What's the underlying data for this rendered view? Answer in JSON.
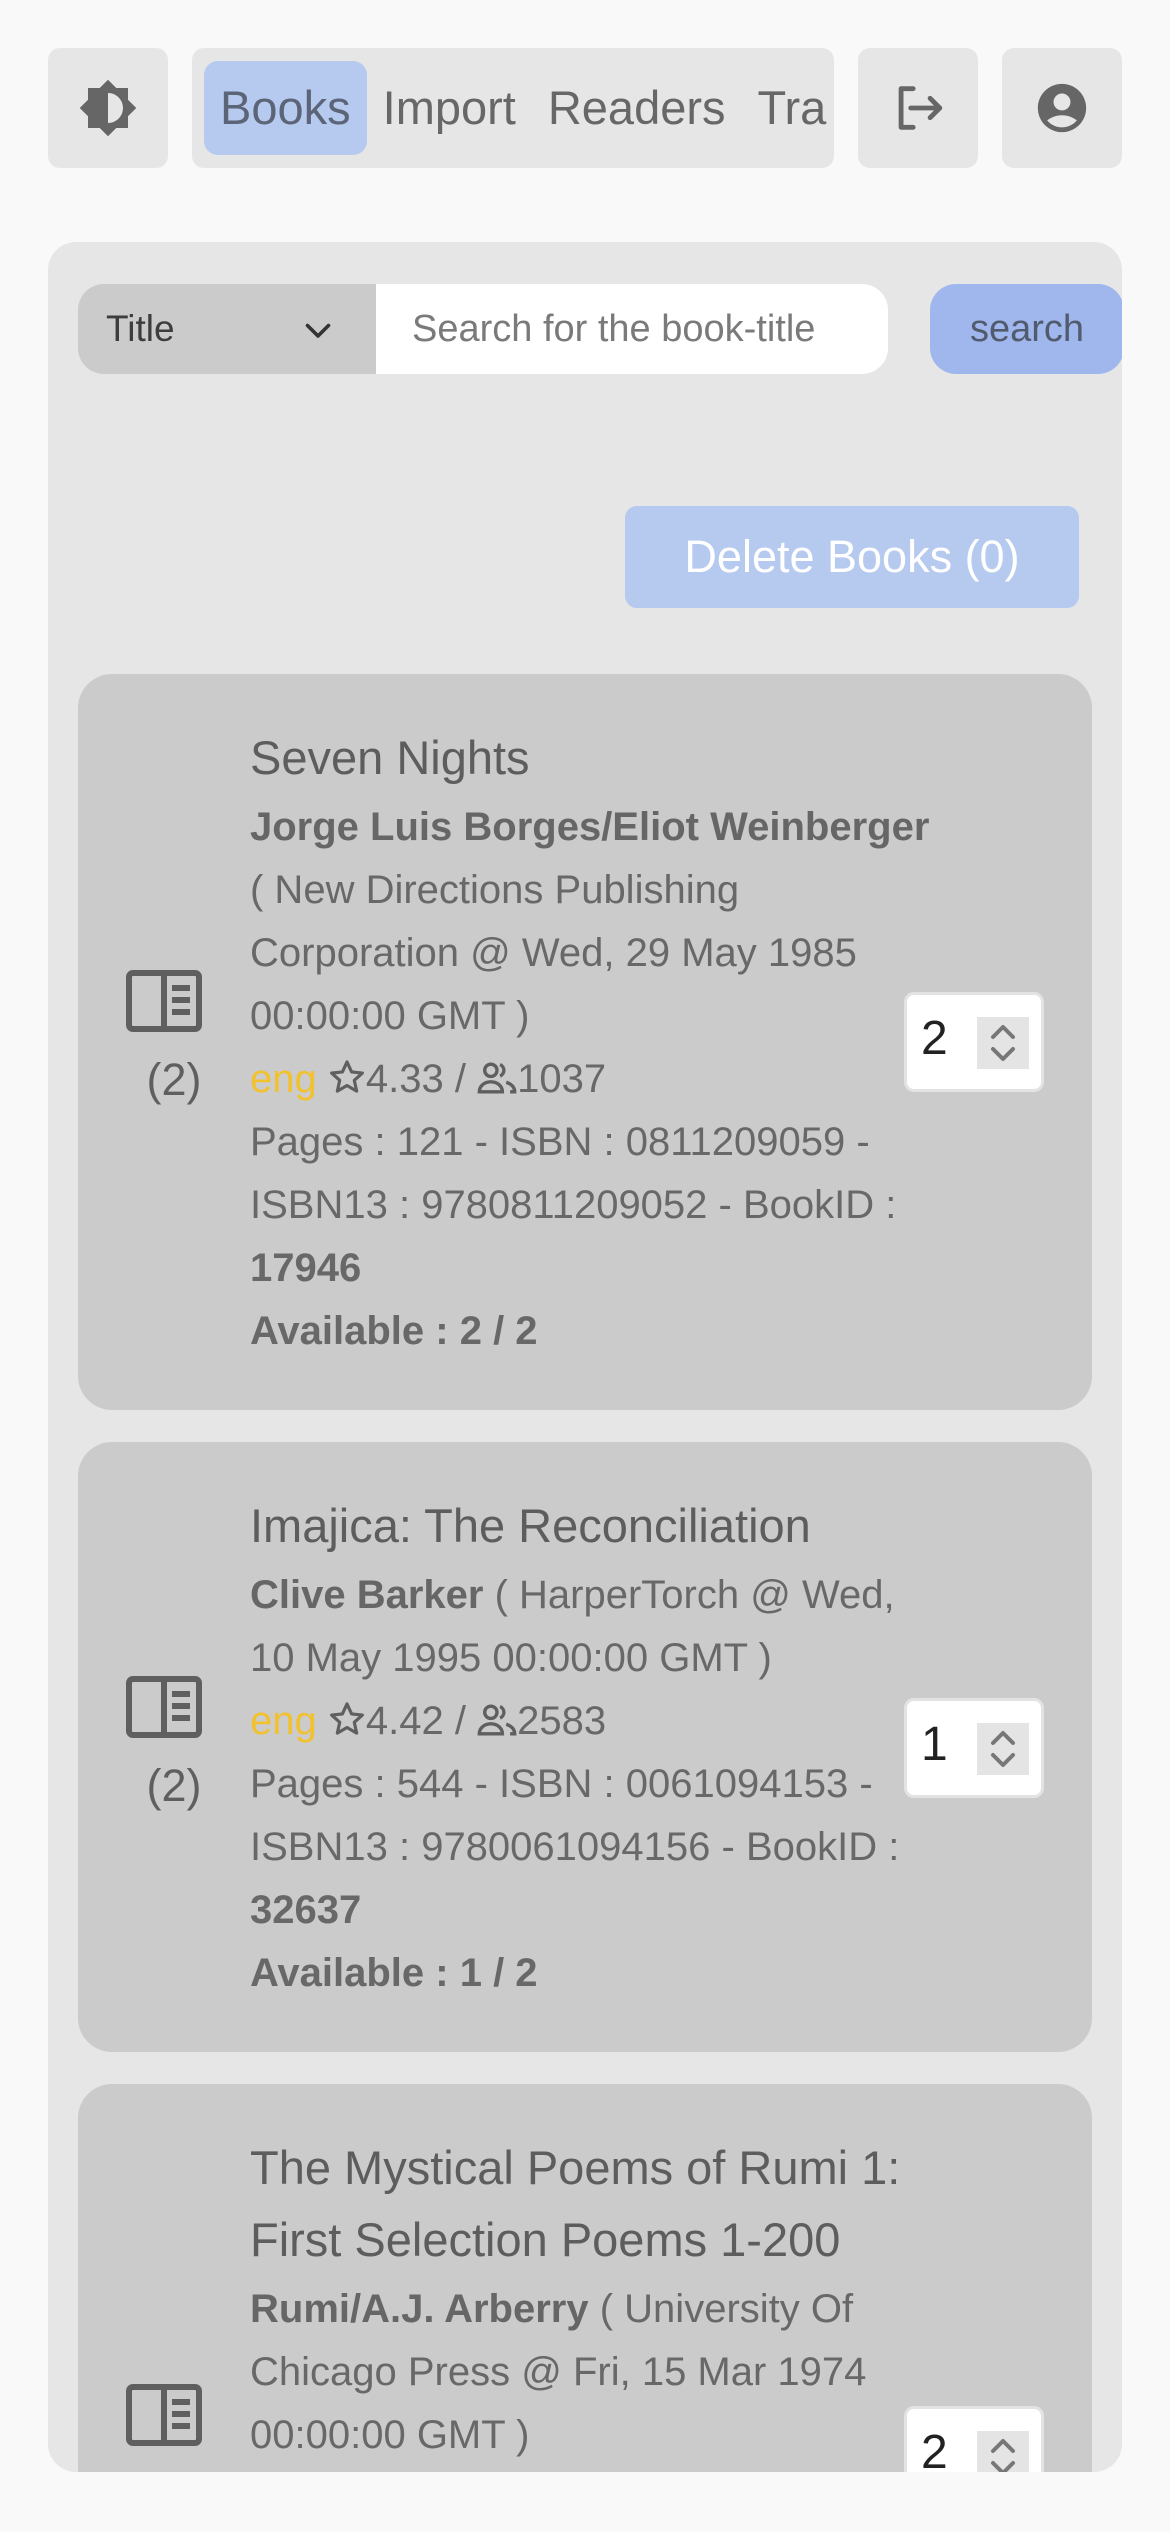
{
  "nav": {
    "tabs": [
      {
        "label": "Books",
        "active": true
      },
      {
        "label": "Import",
        "active": false
      },
      {
        "label": "Readers",
        "active": false
      },
      {
        "label": "Tra",
        "active": false
      }
    ],
    "icons": {
      "theme": "contrast-icon",
      "logout": "logout-icon",
      "account": "account-circle-icon"
    }
  },
  "search": {
    "field_select": "Title",
    "placeholder": "Search for the book-title",
    "value": "",
    "button_label": "search"
  },
  "delete_button_label": "Delete Books (0)",
  "books": [
    {
      "copies": "(2)",
      "title": "Seven Nights",
      "author": "Jorge Luis Borges/Eliot Weinberger",
      "publisher_line": " ( New Directions Publishing Corporation @ Wed, 29 May 1985 00:00:00 GMT )",
      "lang": "eng",
      "rating": "4.33 / ",
      "ratings_count": "1037",
      "details": "Pages : 121 - ISBN : 0811209059 - ISBN13 : 9780811209052 - BookID : ",
      "book_id": "17946",
      "available": "Available : 2 / 2",
      "quantity": "2"
    },
    {
      "copies": "(2)",
      "title": "Imajica: The Reconciliation",
      "author": "Clive Barker",
      "publisher_line": " ( HarperTorch @ Wed, 10 May 1995 00:00:00 GMT )",
      "lang": "eng",
      "rating": "4.42 / ",
      "ratings_count": "2583",
      "details": "Pages : 544 - ISBN : 0061094153 - ISBN13 : 9780061094156 - BookID : ",
      "book_id": "32637",
      "available": "Available : 1 / 2",
      "quantity": "1"
    },
    {
      "title": "The Mystical Poems of Rumi 1: First Selection Poems 1-200",
      "author": "Rumi/A.J. Arberry",
      "publisher_line": " ( University Of Chicago Press @ Fri, 15 Mar 1974 00:00:00 GMT )",
      "quantity": "2"
    }
  ],
  "colors": {
    "accent": "#9fb7ec",
    "accent_light": "#b6c9ee",
    "lang": "#f2c12e",
    "card": "#cbcbcb",
    "panel": "#e6e6e6"
  }
}
